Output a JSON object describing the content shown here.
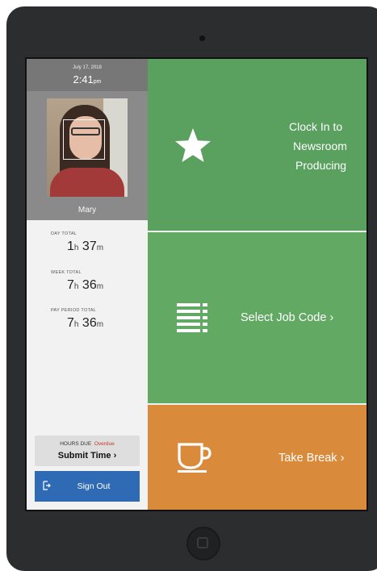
{
  "status": {
    "date": "July 17, 2018",
    "time": "2:41",
    "ampm": "pm"
  },
  "user": {
    "name": "Mary"
  },
  "stats": [
    {
      "label": "DAY TOTAL",
      "hours": "1",
      "minutes": "37",
      "h_unit": "h",
      "m_unit": "m"
    },
    {
      "label": "WEEK TOTAL",
      "hours": "7",
      "minutes": "36",
      "h_unit": "h",
      "m_unit": "m"
    },
    {
      "label": "PAY PERIOD TOTAL",
      "hours": "7",
      "minutes": "36",
      "h_unit": "h",
      "m_unit": "m"
    }
  ],
  "hours_due": {
    "label": "HOURS DUE",
    "status": "Overdue",
    "action": "Submit Time ›"
  },
  "sign_out": {
    "label": "Sign Out"
  },
  "tiles": {
    "clock_in": {
      "lines": [
        "Clock In to",
        "Newsroom",
        "Producing"
      ],
      "icon": "star-icon"
    },
    "job_code": {
      "label": "Select Job Code ›",
      "icon": "list-icon"
    },
    "take_break": {
      "label": "Take Break ›",
      "icon": "coffee-cup-icon"
    }
  },
  "colors": {
    "clock_tile": "#5aa05f",
    "job_tile": "#62a964",
    "break_tile": "#d98a3a",
    "sign_out": "#2f6bb4",
    "overdue": "#c0392b"
  }
}
